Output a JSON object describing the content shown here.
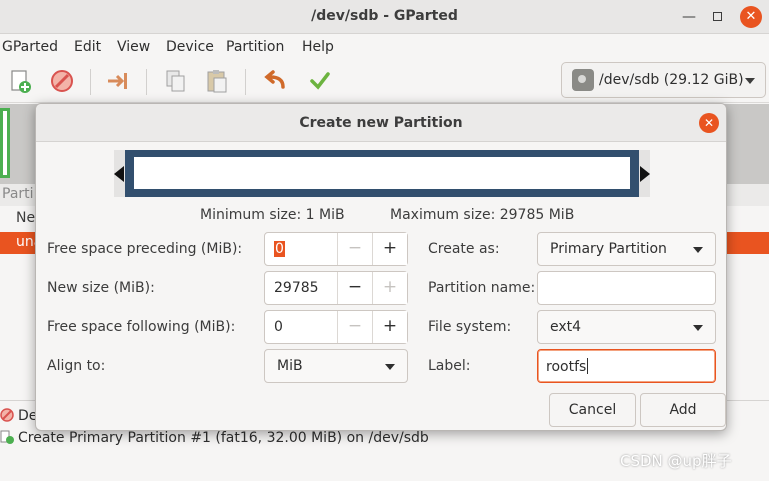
{
  "window": {
    "title": "/dev/sdb - GParted"
  },
  "menu": [
    "GParted",
    "Edit",
    "View",
    "Device",
    "Partition",
    "Help"
  ],
  "device_selector": {
    "value": "/dev/sdb (29.12 GiB)"
  },
  "background": {
    "partial_labels": [
      "Parti",
      "Ne",
      "una",
      "De"
    ],
    "pending_operation": "Create Primary Partition #1 (fat16, 32.00 MiB) on /dev/sdb",
    "watermark": "CSDN @up胖子"
  },
  "dialog": {
    "title": "Create new Partition",
    "min_size": "Minimum size: 1 MiB",
    "max_size": "Maximum size: 29785 MiB",
    "free_preceding": {
      "label": "Free space preceding (MiB):",
      "value": "0"
    },
    "new_size": {
      "label": "New size (MiB):",
      "value": "29785"
    },
    "free_following": {
      "label": "Free space following (MiB):",
      "value": "0"
    },
    "align_to": {
      "label": "Align to:",
      "value": "MiB"
    },
    "create_as": {
      "label": "Create as:",
      "value": "Primary Partition"
    },
    "partition_name": {
      "label": "Partition name:",
      "value": ""
    },
    "file_system": {
      "label": "File system:",
      "value": "ext4"
    },
    "fs_label": {
      "label": "Label:",
      "value": "rootfs"
    },
    "cancel_label": "Cancel",
    "add_label": "Add"
  },
  "colors": {
    "accent": "#e95420",
    "partition_border": "#324f6e",
    "success_green": "#4caf50"
  }
}
